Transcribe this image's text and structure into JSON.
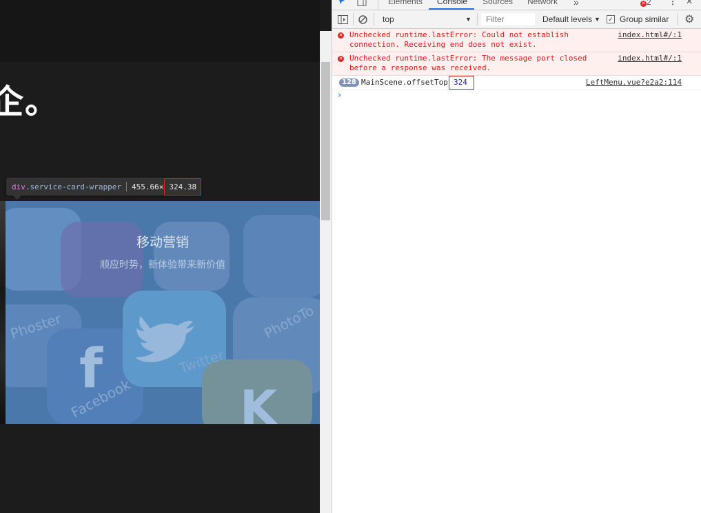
{
  "page": {
    "headline": "企。",
    "card": {
      "title": "移动营销",
      "subtitle": "顺应时势，新体验带来新价值",
      "app_labels": [
        "Phoster",
        "Twitter",
        "PhotoTo",
        "Facebook"
      ]
    },
    "inspect_tooltip": {
      "tag": "div",
      "class": ".service-card-wrapper",
      "width": "455.66",
      "times": "×",
      "height": "324.38"
    }
  },
  "devtools": {
    "tabs": [
      "Elements",
      "Console",
      "Sources",
      "Network"
    ],
    "more_tabs": "»",
    "error_count": "2",
    "context": "top",
    "filter_placeholder": "Filter",
    "levels": "Default levels",
    "group_similar": "Group similar",
    "messages": [
      {
        "type": "error",
        "text": "Unchecked runtime.lastError: Could not establish\nconnection. Receiving end does not exist.",
        "source": "index.html#/:1"
      },
      {
        "type": "error",
        "text": "Unchecked runtime.lastError: The message port closed\nbefore a response was received.",
        "source": "index.html#/:1"
      },
      {
        "type": "log",
        "count": "128",
        "text": "MainScene.offsetTop",
        "value": "324",
        "source": "LeftMenu.vue?e2a2:114"
      }
    ],
    "prompt": "›"
  },
  "colors": {
    "error_text": "#e01b1b",
    "error_bg": "#fff0f0",
    "highlight_box": "#d01919",
    "card_overlay": "#5c8abe",
    "accent_blue": "#1a73e8"
  }
}
